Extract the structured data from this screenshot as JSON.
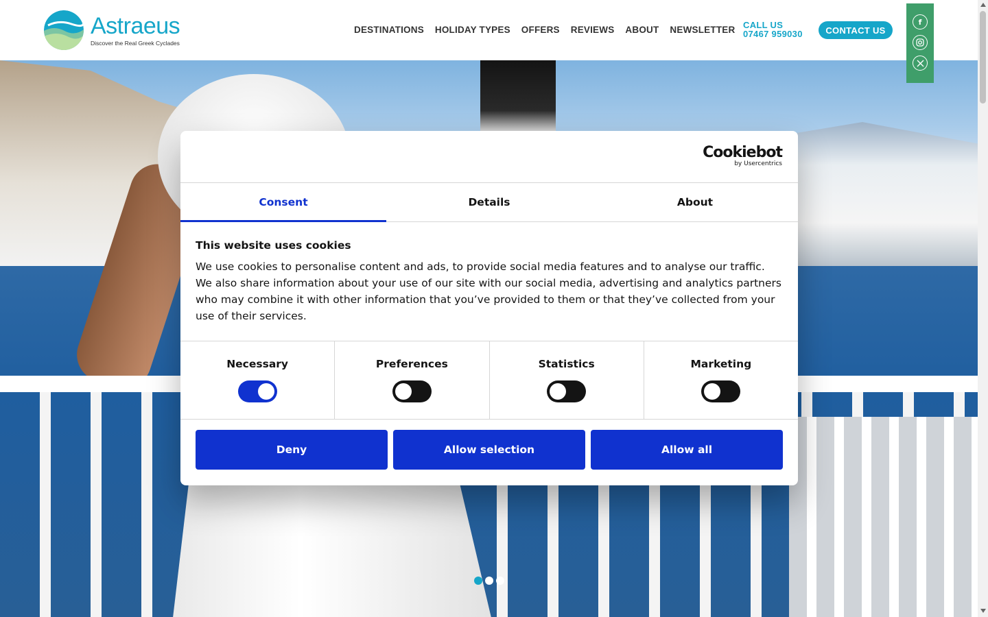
{
  "header": {
    "logo_name": "Astraeus",
    "logo_tagline": "Discover the Real Greek Cyclades",
    "nav": [
      "DESTINATIONS",
      "HOLIDAY TYPES",
      "OFFERS",
      "REVIEWS",
      "ABOUT",
      "NEWSLETTER"
    ],
    "call_label": "CALL US",
    "phone": "07467 959030",
    "contact_label": "CONTACT US",
    "social": [
      "facebook-icon",
      "instagram-icon",
      "x-icon"
    ]
  },
  "hero": {
    "slides": 3,
    "active_slide": 1
  },
  "cookie": {
    "brand": "Cookiebot",
    "brand_by": "by Usercentrics",
    "tabs": [
      "Consent",
      "Details",
      "About"
    ],
    "active_tab": "Consent",
    "title": "This website uses cookies",
    "text": "We use cookies to personalise content and ads, to provide social media features and to analyse our traffic. We also share information about your use of our site with our social media, advertising and analytics partners who may combine it with other information that you’ve provided to them or that they’ve collected from your use of their services.",
    "categories": [
      {
        "label": "Necessary",
        "enabled": true
      },
      {
        "label": "Preferences",
        "enabled": false
      },
      {
        "label": "Statistics",
        "enabled": false
      },
      {
        "label": "Marketing",
        "enabled": false
      }
    ],
    "buttons": {
      "deny": "Deny",
      "allow_selection": "Allow selection",
      "allow_all": "Allow all"
    }
  },
  "colors": {
    "brand_teal": "#16a6c9",
    "social_green": "#3f9e6a",
    "cookie_blue": "#1032cf"
  }
}
